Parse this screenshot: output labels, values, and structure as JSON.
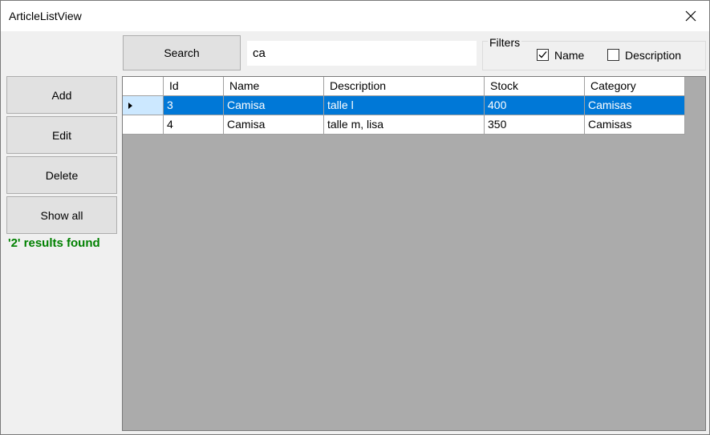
{
  "window": {
    "title": "ArticleListView"
  },
  "toolbar": {
    "search_label": "Search",
    "search_value": "ca"
  },
  "filters": {
    "legend": "Filters",
    "name": {
      "label": "Name",
      "checked": true
    },
    "description": {
      "label": "Description",
      "checked": false
    }
  },
  "side": {
    "add_label": "Add",
    "edit_label": "Edit",
    "delete_label": "Delete",
    "show_all_label": "Show all"
  },
  "status": {
    "text": "'2' results found",
    "color": "#008000"
  },
  "grid": {
    "columns": [
      "Id",
      "Name",
      "Description",
      "Stock",
      "Category"
    ],
    "rows": [
      {
        "id": "3",
        "name": "Camisa",
        "description": "talle l",
        "stock": "400",
        "category": "Camisas",
        "selected": true
      },
      {
        "id": "4",
        "name": "Camisa",
        "description": "talle m, lisa",
        "stock": "350",
        "category": "Camisas",
        "selected": false
      }
    ],
    "selection_color": "#0078d7"
  }
}
